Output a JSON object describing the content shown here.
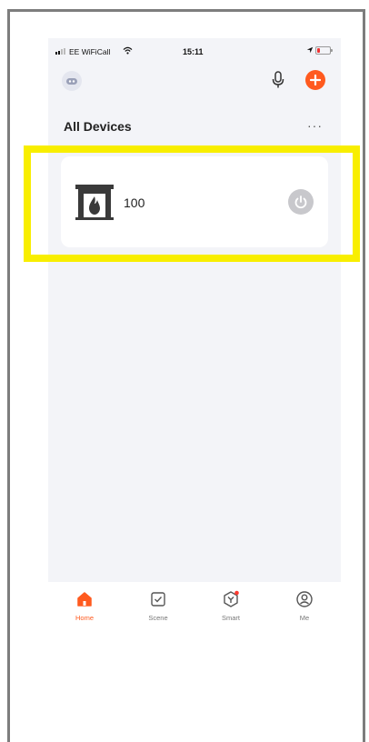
{
  "status_bar": {
    "carrier": "EE WiFiCall",
    "time": "15:11"
  },
  "header": {
    "home_icon": "home-avatar-icon",
    "mic_icon": "microphone-icon",
    "add_icon": "plus-icon"
  },
  "section": {
    "title": "All Devices",
    "more": "···"
  },
  "device": {
    "name": "100",
    "icon": "fireplace-icon",
    "power_icon": "power-icon"
  },
  "tabs": [
    {
      "label": "Home",
      "icon": "home-icon",
      "active": true
    },
    {
      "label": "Scene",
      "icon": "scene-check-icon",
      "active": false
    },
    {
      "label": "Smart",
      "icon": "smart-icon",
      "active": false
    },
    {
      "label": "Me",
      "icon": "profile-icon",
      "active": false
    }
  ],
  "colors": {
    "accent": "#ff5a1f",
    "highlight": "#f8ee00",
    "screen_bg": "#f3f4f8",
    "power_off": "#c8c8cc"
  }
}
